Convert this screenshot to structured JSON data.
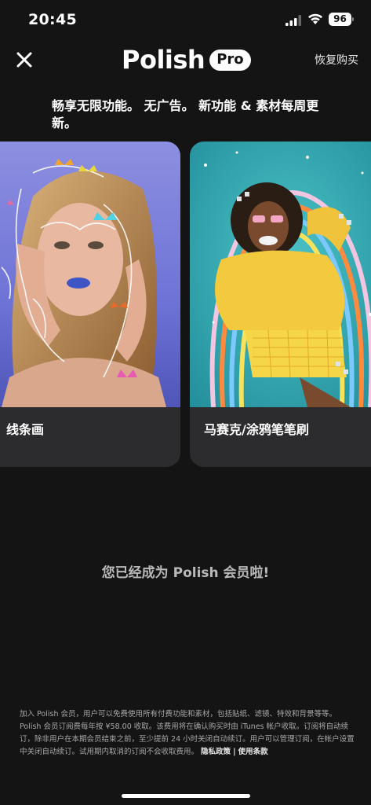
{
  "status_bar": {
    "time": "20:45",
    "battery": "96",
    "icons": [
      "signal-icon",
      "wifi-icon",
      "battery-icon"
    ]
  },
  "header": {
    "close_icon": "close-icon",
    "logo_text": "Polish",
    "logo_badge": "Pro",
    "restore_label": "恢复购买"
  },
  "tagline": "畅享无限功能。 无广告。 新功能 & 素材每周更新。",
  "cards": [
    {
      "label": "线条画",
      "image": "portrait-line-art-butterflies"
    },
    {
      "label": "马赛克/涂鸦笔笔刷",
      "image": "woman-yellow-outfit-doodle-brush"
    }
  ],
  "member_message": "您已经成为 Polish 会员啦!",
  "legal": {
    "text": "加入 Polish 会员，用户可以免费使用所有付费功能和素材，包括贴纸、滤镜、特效和背景等等。Polish 会员订阅费每年按 ¥58.00 收取。该费用将在确认购买时由 iTunes 帐户收取。订阅将自动续订，除非用户在本期会员结束之前，至少提前 24 小时关闭自动续订。用户可以管理订阅，在帐户设置中关闭自动续订。试用期内取消的订阅不会收取费用。",
    "privacy_label": "隐私政策",
    "separator": "|",
    "terms_label": "使用条款"
  },
  "colors": {
    "background": "#141414",
    "card": "#2c2c2e",
    "muted_text": "#b9b9b9"
  }
}
